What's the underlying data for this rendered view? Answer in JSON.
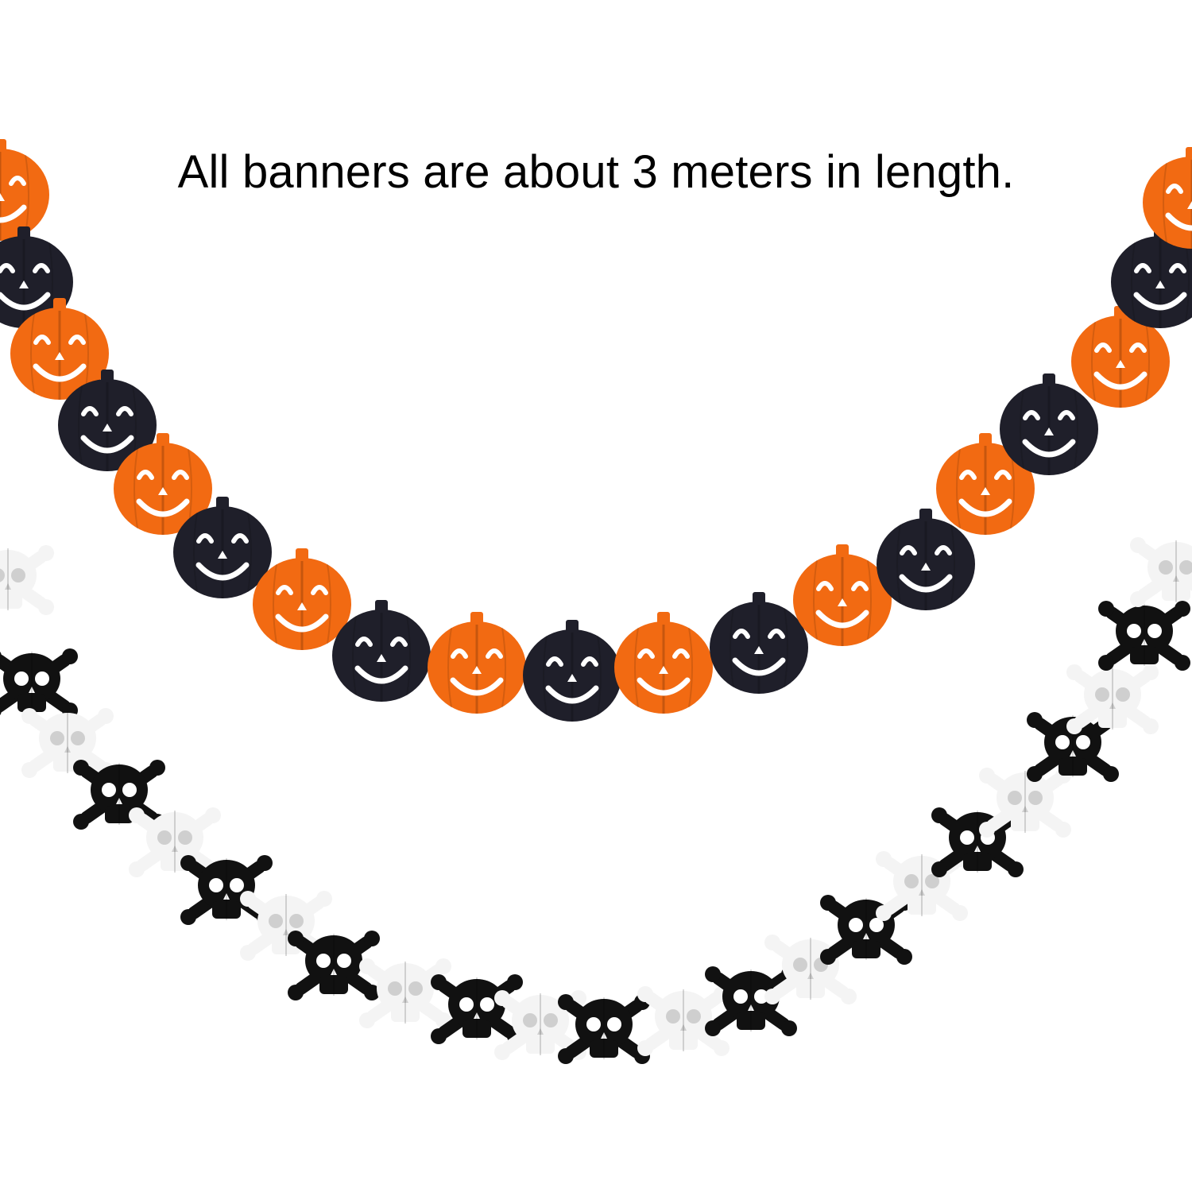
{
  "caption": "All banners are about 3 meters in length.",
  "pumpkin_garland": {
    "pattern": [
      "orange",
      "black"
    ],
    "face": "jack-o-lantern"
  },
  "skull_garland": {
    "pattern": [
      "white",
      "black"
    ],
    "face": "skull-and-crossbones"
  },
  "colors": {
    "orange": "#f26a12",
    "black": "#1f1f2a",
    "white": "#f4f4f4",
    "skull_black": "#111111",
    "background": "#ffffff"
  }
}
